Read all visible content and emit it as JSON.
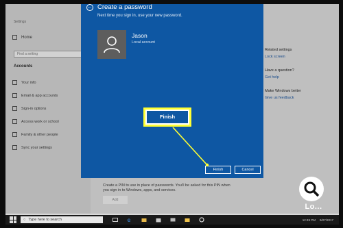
{
  "settings": {
    "title": "Settings",
    "home": "Home",
    "search_placeholder": "Find a setting",
    "section": "Accounts",
    "nav": [
      {
        "label": "Your info",
        "icon": "person-icon"
      },
      {
        "label": "Email & app accounts",
        "icon": "mail-icon"
      },
      {
        "label": "Sign-in options",
        "icon": "key-icon"
      },
      {
        "label": "Access work or school",
        "icon": "briefcase-icon"
      },
      {
        "label": "Family & other people",
        "icon": "people-icon"
      },
      {
        "label": "Sync your settings",
        "icon": "sync-icon"
      }
    ],
    "pin_text": "Create a PIN to use in place of passwords. You'll be asked for this PIN when you sign in to Windows, apps, and services.",
    "add_button": "Add",
    "related": {
      "heading1": "Related settings",
      "link1": "Lock screen",
      "heading2": "Have a question?",
      "link2": "Get help",
      "heading3": "Make Windows better",
      "link3": "Give us feedback"
    }
  },
  "dialog": {
    "title": "Create a password",
    "subtitle": "Next time you sign in, use your new password.",
    "user_name": "Jason",
    "account_type": "Local account",
    "finish_highlight": "Finish",
    "finish": "Finish",
    "cancel": "Cancel"
  },
  "taskbar": {
    "search": "Type here to search",
    "time": "12:49 PM",
    "date": "9/27/2017"
  },
  "watermark": {
    "text": "Lo..."
  },
  "colors": {
    "dialog_blue": "#0e57a3",
    "highlight_yellow": "#ffff33"
  }
}
